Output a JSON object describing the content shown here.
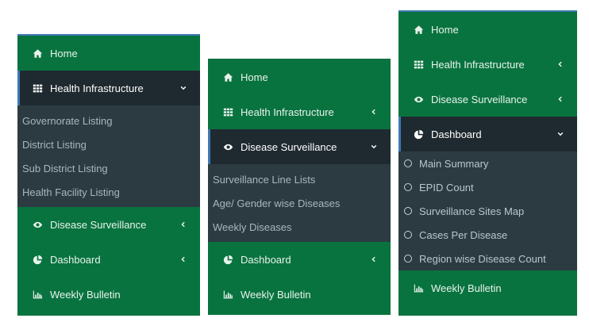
{
  "panel1": {
    "items": {
      "home": {
        "label": "Home",
        "icon": "home-icon"
      },
      "health": {
        "label": "Health Infrastructure",
        "icon": "grid-icon",
        "chevron": "chevron-down-icon"
      },
      "disease": {
        "label": "Disease Surveillance",
        "icon": "eye-icon",
        "chevron": "chevron-left-icon"
      },
      "dashboard": {
        "label": "Dashboard",
        "icon": "pie-chart-icon",
        "chevron": "chevron-left-icon"
      },
      "weekly": {
        "label": "Weekly Bulletin",
        "icon": "bar-chart-icon"
      }
    },
    "submenu": [
      "Governorate Listing",
      "District Listing",
      "Sub District Listing",
      "Health Facility Listing"
    ]
  },
  "panel2": {
    "items": {
      "home": {
        "label": "Home",
        "icon": "home-icon"
      },
      "health": {
        "label": "Health Infrastructure",
        "icon": "grid-icon",
        "chevron": "chevron-left-icon"
      },
      "disease": {
        "label": "Disease Surveillance",
        "icon": "eye-icon",
        "chevron": "chevron-down-icon"
      },
      "dashboard": {
        "label": "Dashboard",
        "icon": "pie-chart-icon",
        "chevron": "chevron-left-icon"
      },
      "weekly": {
        "label": "Weekly Bulletin",
        "icon": "bar-chart-icon"
      }
    },
    "submenu": [
      "Surveillance Line Lists",
      "Age/ Gender wise Diseases",
      "Weekly Diseases"
    ]
  },
  "panel3": {
    "items": {
      "home": {
        "label": "Home",
        "icon": "home-icon"
      },
      "health": {
        "label": "Health Infrastructure",
        "icon": "grid-icon",
        "chevron": "chevron-left-icon"
      },
      "disease": {
        "label": "Disease Surveillance",
        "icon": "eye-icon",
        "chevron": "chevron-left-icon"
      },
      "dashboard": {
        "label": "Dashboard",
        "icon": "pie-chart-icon",
        "chevron": "chevron-down-icon"
      },
      "weekly": {
        "label": "Weekly Bulletin",
        "icon": "bar-chart-icon"
      }
    },
    "submenu": [
      "Main Summary",
      "EPID Count",
      "Surveillance Sites Map",
      "Cases Per Disease",
      "Region wise Disease Count"
    ]
  },
  "colors": {
    "sidebar_green": "#09733f",
    "active_dark": "#1f2a30",
    "submenu_bg": "#2c3b41",
    "accent_blue": "#3c78b4"
  }
}
